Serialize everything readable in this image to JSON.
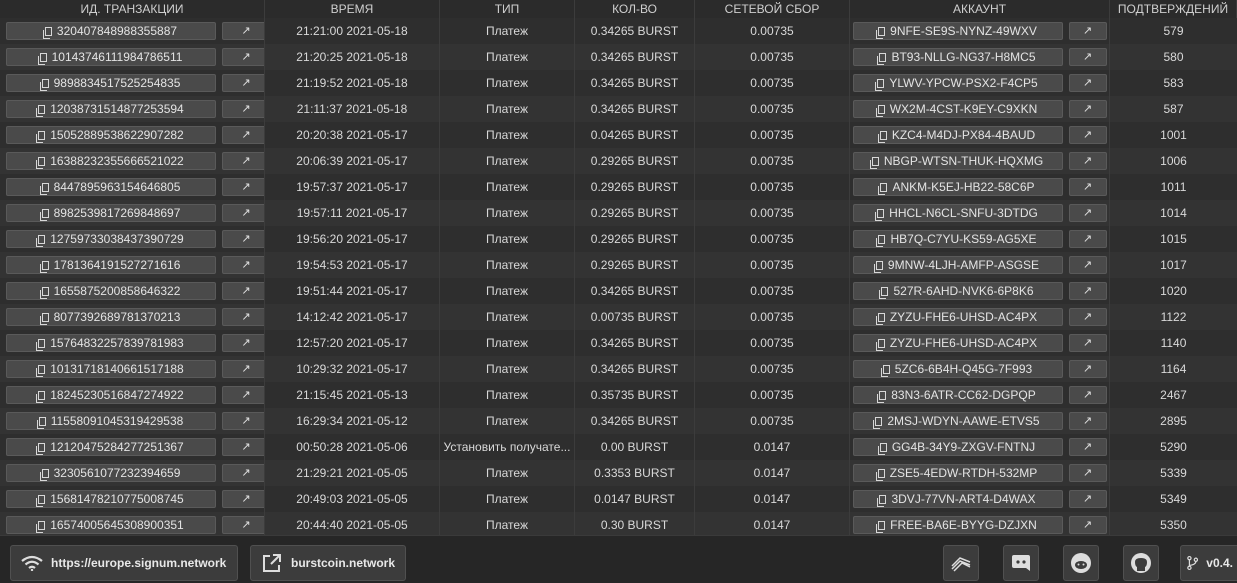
{
  "headers": [
    "ИД. ТРАНЗАКЦИИ",
    "ВРЕМЯ",
    "ТИП",
    "КОЛ-ВО",
    "СЕТЕВОЙ СБОР",
    "АККАУНТ",
    "ПОДТВЕРЖДЕНИЙ"
  ],
  "rows": [
    {
      "id": "3204078489883558 87",
      "time": "21:21:00 2021-05-18",
      "type": "Платеж",
      "amount": "0.34265 BURST",
      "fee": "0.00735",
      "account": "9NFE-SE9S-NYNZ-49WXV",
      "conf": "579"
    },
    {
      "id": "10143746111984786511",
      "time": "21:20:25 2021-05-18",
      "type": "Платеж",
      "amount": "0.34265 BURST",
      "fee": "0.00735",
      "account": "BT93-NLLG-NG37-H8MC5",
      "conf": "580"
    },
    {
      "id": "9898834517525254835",
      "time": "21:19:52 2021-05-18",
      "type": "Платеж",
      "amount": "0.34265 BURST",
      "fee": "0.00735",
      "account": "YLWV-YPCW-PSX2-F4CP5",
      "conf": "583"
    },
    {
      "id": "12038731514877253594",
      "time": "21:11:37 2021-05-18",
      "type": "Платеж",
      "amount": "0.34265 BURST",
      "fee": "0.00735",
      "account": "WX2M-4CST-K9EY-C9XKN",
      "conf": "587"
    },
    {
      "id": "15052889538622907282",
      "time": "20:20:38 2021-05-17",
      "type": "Платеж",
      "amount": "0.04265 BURST",
      "fee": "0.00735",
      "account": "KZC4-M4DJ-PX84-4BAUD",
      "conf": "1001"
    },
    {
      "id": "16388232355666521022",
      "time": "20:06:39 2021-05-17",
      "type": "Платеж",
      "amount": "0.29265 BURST",
      "fee": "0.00735",
      "account": "NBGP-WTSN-THUK-HQXMG",
      "conf": "1006"
    },
    {
      "id": "8447895963154646805",
      "time": "19:57:37 2021-05-17",
      "type": "Платеж",
      "amount": "0.29265 BURST",
      "fee": "0.00735",
      "account": "ANKM-K5EJ-HB22-58C6P",
      "conf": "1011"
    },
    {
      "id": "8982539817269848697",
      "time": "19:57:11 2021-05-17",
      "type": "Платеж",
      "amount": "0.29265 BURST",
      "fee": "0.00735",
      "account": "HHCL-N6CL-SNFU-3DTDG",
      "conf": "1014"
    },
    {
      "id": "12759733038437390729",
      "time": "19:56:20 2021-05-17",
      "type": "Платеж",
      "amount": "0.29265 BURST",
      "fee": "0.00735",
      "account": "HB7Q-C7YU-KS59-AG5XE",
      "conf": "1015"
    },
    {
      "id": "1781364191527271616",
      "time": "19:54:53 2021-05-17",
      "type": "Платеж",
      "amount": "0.29265 BURST",
      "fee": "0.00735",
      "account": "9MNW-4LJH-AMFP-ASGSE",
      "conf": "1017"
    },
    {
      "id": "1655875200858646322",
      "time": "19:51:44 2021-05-17",
      "type": "Платеж",
      "amount": "0.34265 BURST",
      "fee": "0.00735",
      "account": "527R-6AHD-NVK6-6P8K6",
      "conf": "1020"
    },
    {
      "id": "8077392689781370213",
      "time": "14:12:42 2021-05-17",
      "type": "Платеж",
      "amount": "0.00735 BURST",
      "fee": "0.00735",
      "account": "ZYZU-FHE6-UHSD-AC4PX",
      "conf": "1122"
    },
    {
      "id": "15764832257839781983",
      "time": "12:57:20 2021-05-17",
      "type": "Платеж",
      "amount": "0.34265 BURST",
      "fee": "0.00735",
      "account": "ZYZU-FHE6-UHSD-AC4PX",
      "conf": "1140"
    },
    {
      "id": "10131718140661517188",
      "time": "10:29:32 2021-05-17",
      "type": "Платеж",
      "amount": "0.34265 BURST",
      "fee": "0.00735",
      "account": "5ZC6-6B4H-Q45G-7F993",
      "conf": "1164"
    },
    {
      "id": "18245230516847274922",
      "time": "21:15:45 2021-05-13",
      "type": "Платеж",
      "amount": "0.35735 BURST",
      "fee": "0.00735",
      "account": "83N3-6ATR-CC62-DGPQP",
      "conf": "2467"
    },
    {
      "id": "11558091045319429538",
      "time": "16:29:34 2021-05-12",
      "type": "Платеж",
      "amount": "0.34265 BURST",
      "fee": "0.00735",
      "account": "2MSJ-WDYN-AAWE-ETVS5",
      "conf": "2895"
    },
    {
      "id": "12120475284277251367",
      "time": "00:50:28 2021-05-06",
      "type": "Установить получате...",
      "amount": "0.00 BURST",
      "fee": "0.0147",
      "account": "GG4B-34Y9-ZXGV-FNTNJ",
      "conf": "5290"
    },
    {
      "id": "3230561077232394659",
      "time": "21:29:21 2021-05-05",
      "type": "Платеж",
      "amount": "0.3353 BURST",
      "fee": "0.0147",
      "account": "ZSE5-4EDW-RTDH-532MP",
      "conf": "5339"
    },
    {
      "id": "15681478210775008745",
      "time": "20:49:03 2021-05-05",
      "type": "Платеж",
      "amount": "0.0147 BURST",
      "fee": "0.0147",
      "account": "3DVJ-77VN-ART4-D4WAX",
      "conf": "5349"
    },
    {
      "id": "16574005645308900351",
      "time": "20:44:40 2021-05-05",
      "type": "Платеж",
      "amount": "0.30 BURST",
      "fee": "0.0147",
      "account": "FREE-BA6E-BYYG-DZJXN",
      "conf": "5350"
    }
  ],
  "footer": {
    "node": "https://europe.signum.network",
    "site": "burstcoin.network",
    "version": "v0.4."
  }
}
